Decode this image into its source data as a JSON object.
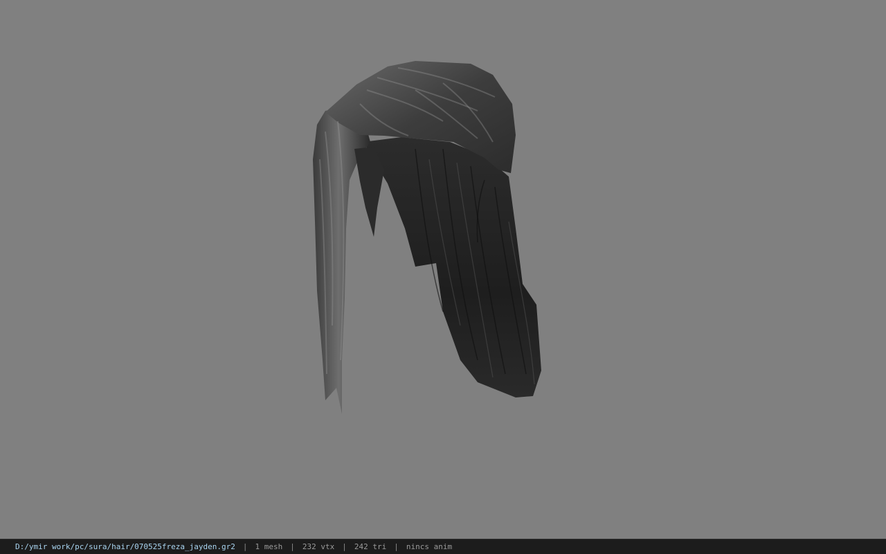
{
  "viewer": {
    "background_color": "#808080",
    "model_icon": "hair-mesh"
  },
  "status": {
    "file_path": "D:/ymir work/pc/sura/hair/070525freza_jayden.gr2",
    "separator": "|",
    "mesh_count": "1 mesh",
    "vertex_count": "232 vtx",
    "triangle_count": "242 tri",
    "anim_status": "nincs anim"
  }
}
